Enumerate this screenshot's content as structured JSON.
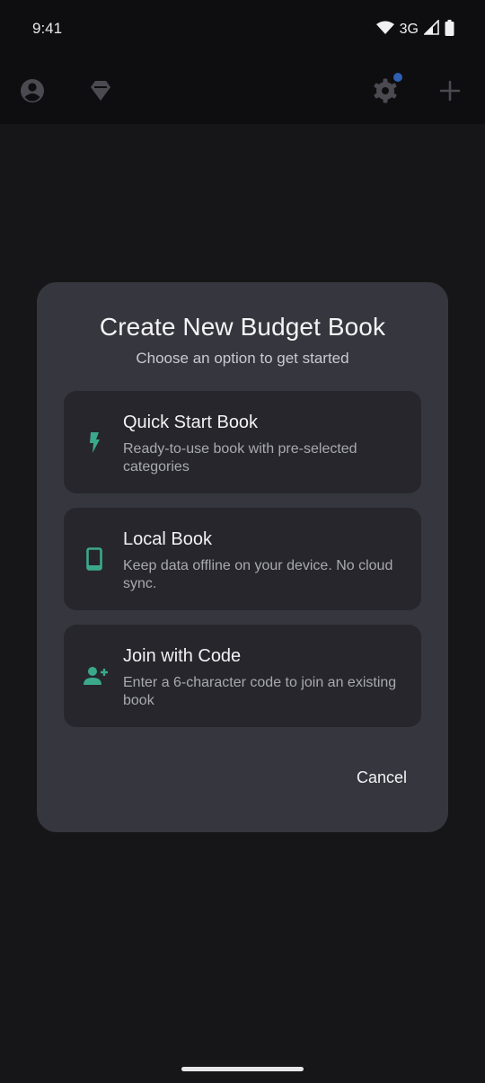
{
  "status_bar": {
    "time": "9:41",
    "network": "3G",
    "icons": [
      "wifi-icon",
      "signal-icon",
      "battery-icon"
    ]
  },
  "app_bar": {
    "icons": [
      "account-icon",
      "premium-gem-icon",
      "settings-icon",
      "add-icon"
    ]
  },
  "dialog": {
    "title": "Create New Budget Book",
    "subtitle": "Choose an option to get started",
    "options": [
      {
        "icon": "lightning-bolt-icon",
        "title": "Quick Start Book",
        "description": "Ready-to-use book with pre-selected categories"
      },
      {
        "icon": "phone-device-icon",
        "title": "Local Book",
        "description": "Keep data offline on your device. No cloud sync."
      },
      {
        "icon": "person-add-icon",
        "title": "Join with Code",
        "description": "Enter a 6-character code to join an existing book"
      }
    ],
    "cancel_label": "Cancel"
  },
  "colors": {
    "accent": "#3ba88c",
    "background": "#161618",
    "dialog": "#36363e",
    "option_card": "#26262c",
    "notification_dot": "#2e5fb1"
  }
}
